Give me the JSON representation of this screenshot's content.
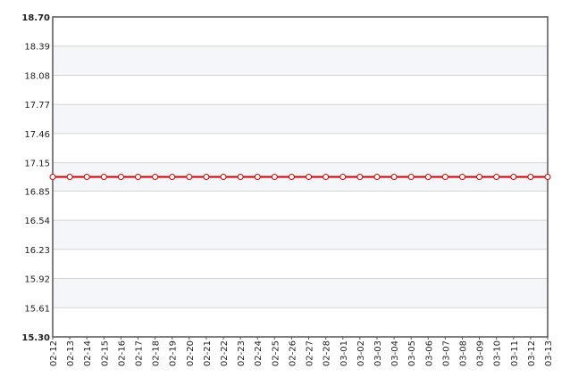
{
  "chart_data": {
    "type": "line",
    "title": "",
    "xlabel": "",
    "ylabel": "",
    "categories": [
      "02-12",
      "02-13",
      "02-14",
      "02-15",
      "02-16",
      "02-17",
      "02-18",
      "02-19",
      "02-20",
      "02-21",
      "02-22",
      "02-23",
      "02-24",
      "02-25",
      "02-26",
      "02-27",
      "02-28",
      "03-01",
      "03-02",
      "03-03",
      "03-04",
      "03-05",
      "03-06",
      "03-07",
      "03-08",
      "03-09",
      "03-10",
      "03-11",
      "03-12",
      "03-13"
    ],
    "series": [
      {
        "values": [
          17.0,
          17.0,
          17.0,
          17.0,
          17.0,
          17.0,
          17.0,
          17.0,
          17.0,
          17.0,
          17.0,
          17.0,
          17.0,
          17.0,
          17.0,
          17.0,
          17.0,
          17.0,
          17.0,
          17.0,
          17.0,
          17.0,
          17.0,
          17.0,
          17.0,
          17.0,
          17.0,
          17.0,
          17.0,
          17.0
        ]
      }
    ],
    "ylim": [
      15.3,
      18.7
    ],
    "yticks": [
      "15.30",
      "15.61",
      "15.92",
      "16.23",
      "16.54",
      "16.85",
      "17.15",
      "17.46",
      "17.77",
      "18.08",
      "18.39",
      "18.70"
    ],
    "grid": true,
    "colors": {
      "line": "#cc0000",
      "marker_fill": "#ffffff",
      "marker_stroke": "#cc0000",
      "band": "#f5f6fa",
      "grid": "#d4d4d4",
      "axis": "#555555"
    }
  }
}
